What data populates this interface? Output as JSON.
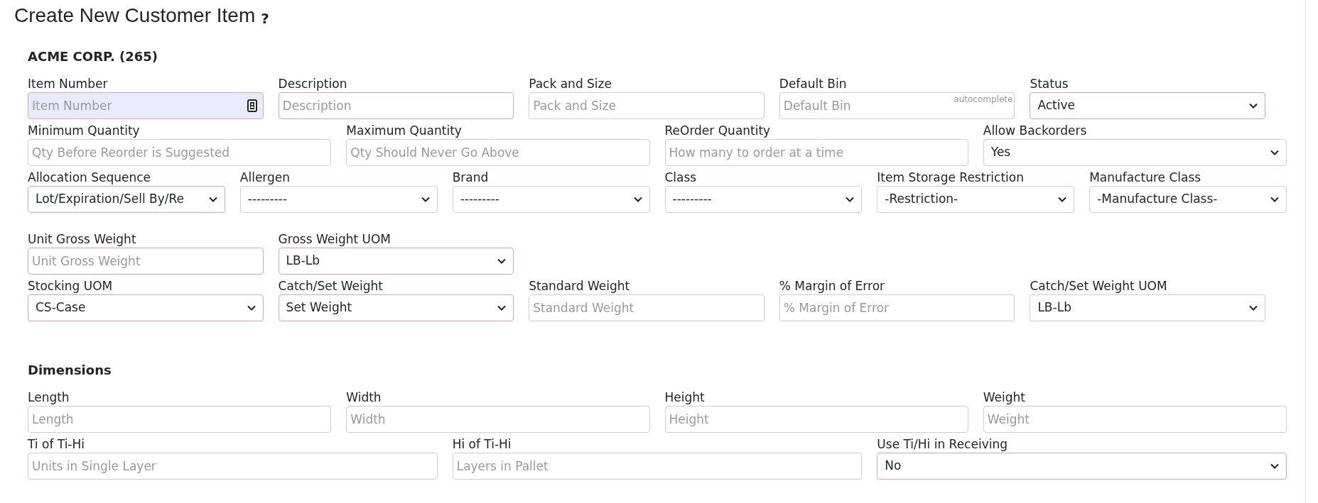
{
  "page": {
    "title": "Create New Customer Item",
    "help": "?"
  },
  "sections": [
    {
      "heading": "ACME CORP. (265)",
      "rows": [
        {
          "kind": "fifths",
          "fields": [
            {
              "label": "Item Number",
              "kind": "input",
              "placeholder": "Item Number",
              "required": true,
              "focused": true
            },
            {
              "label": "Description",
              "kind": "input",
              "placeholder": "Description",
              "required": true,
              "focused": false
            },
            {
              "label": "Pack and Size",
              "kind": "input",
              "placeholder": "Pack and Size",
              "required": false,
              "focused": false
            },
            {
              "label": "Default Bin",
              "kind": "input",
              "placeholder": "Default Bin",
              "hint": "autocomplete",
              "required": false,
              "focused": false
            },
            {
              "label": "Status",
              "kind": "select",
              "value": "Active",
              "required": true,
              "focused": false
            }
          ]
        },
        {
          "kind": "quarters",
          "fields": [
            {
              "label": "Minimum Quantity",
              "kind": "input",
              "placeholder": "Qty Before Reorder is Suggested",
              "required": false,
              "focused": false
            },
            {
              "label": "Maximum Quantity",
              "kind": "input",
              "placeholder": "Qty Should Never Go Above",
              "required": false,
              "focused": false
            },
            {
              "label": "ReOrder Quantity",
              "kind": "input",
              "placeholder": "How many to order at a time",
              "required": false,
              "focused": false
            },
            {
              "label": "Allow Backorders",
              "kind": "select",
              "value": "Yes",
              "required": false,
              "focused": false
            }
          ]
        },
        {
          "kind": "sixths",
          "fields": [
            {
              "label": "Allocation Sequence",
              "kind": "select",
              "value": "Lot/Expiration/Sell By/Re",
              "required": true,
              "focused": false
            },
            {
              "label": "Allergen",
              "kind": "select",
              "value": "---------",
              "required": false,
              "focused": false
            },
            {
              "label": "Brand",
              "kind": "select",
              "value": "---------",
              "required": false,
              "focused": false
            },
            {
              "label": "Class",
              "kind": "select",
              "value": "---------",
              "required": false,
              "focused": false
            },
            {
              "label": "Item Storage Restriction",
              "kind": "select",
              "value": "-Restriction-",
              "required": false,
              "focused": false
            },
            {
              "label": "Manufacture Class",
              "kind": "select",
              "value": "-Manufacture Class-",
              "required": false,
              "focused": false
            }
          ]
        }
      ]
    },
    {
      "rows": [
        {
          "kind": "fifths",
          "fields": [
            {
              "label": "Unit Gross Weight",
              "kind": "input",
              "placeholder": "Unit Gross Weight",
              "required": true,
              "focused": false
            },
            {
              "label": "Gross Weight UOM",
              "kind": "select",
              "value": "LB-Lb",
              "required": true,
              "focused": false
            }
          ]
        },
        {
          "kind": "fifths",
          "fields": [
            {
              "label": "Stocking UOM",
              "kind": "select",
              "value": "CS-Case",
              "required": true,
              "focused": false
            },
            {
              "label": "Catch/Set Weight",
              "kind": "select",
              "value": "Set Weight",
              "required": true,
              "focused": false
            },
            {
              "label": "Standard Weight",
              "kind": "input",
              "placeholder": "Standard Weight",
              "required": false,
              "focused": false
            },
            {
              "label": "% Margin of Error",
              "kind": "input",
              "placeholder": "% Margin of Error",
              "required": false,
              "focused": false
            },
            {
              "label": "Catch/Set Weight UOM",
              "kind": "select",
              "value": "LB-Lb",
              "required": false,
              "focused": false
            }
          ]
        }
      ]
    },
    {
      "heading": "Dimensions",
      "rows": [
        {
          "kind": "quarters",
          "fields": [
            {
              "label": "Length",
              "kind": "input",
              "placeholder": "Length",
              "required": false,
              "focused": false
            },
            {
              "label": "Width",
              "kind": "input",
              "placeholder": "Width",
              "required": false,
              "focused": false
            },
            {
              "label": "Height",
              "kind": "input",
              "placeholder": "Height",
              "required": false,
              "focused": false
            },
            {
              "label": "Weight",
              "kind": "input",
              "placeholder": "Weight",
              "required": false,
              "focused": false
            }
          ]
        },
        {
          "kind": "thirds",
          "fields": [
            {
              "label": "Ti of Ti-Hi",
              "kind": "input",
              "placeholder": "Units in Single Layer",
              "required": false,
              "focused": false
            },
            {
              "label": "Hi of Ti-Hi",
              "kind": "input",
              "placeholder": "Layers in Pallet",
              "required": false,
              "focused": false
            },
            {
              "label": "Use Ti/Hi in Receiving",
              "kind": "select",
              "value": "No",
              "required": true,
              "focused": false
            }
          ]
        }
      ]
    }
  ]
}
